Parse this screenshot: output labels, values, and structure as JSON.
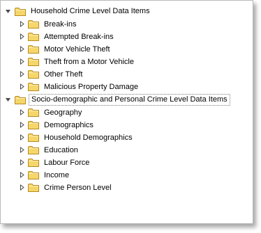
{
  "tree": {
    "groups": [
      {
        "label": "Household Crime Level Data Items",
        "expanded": true,
        "selected": false,
        "children": [
          {
            "label": "Break-ins"
          },
          {
            "label": "Attempted Break-ins"
          },
          {
            "label": "Motor Vehicle Theft"
          },
          {
            "label": "Theft from a Motor Vehicle"
          },
          {
            "label": "Other Theft"
          },
          {
            "label": "Malicious Property Damage"
          }
        ]
      },
      {
        "label": "Socio-demographic and Personal Crime Level Data Items",
        "expanded": true,
        "selected": true,
        "children": [
          {
            "label": "Geography"
          },
          {
            "label": "Demographics"
          },
          {
            "label": "Household Demographics"
          },
          {
            "label": "Education"
          },
          {
            "label": "Labour Force"
          },
          {
            "label": "Income"
          },
          {
            "label": "Crime Person Level"
          }
        ]
      }
    ]
  },
  "icons": {
    "expanded": "triangle-down-icon",
    "collapsed": "triangle-right-icon",
    "folder": "folder-icon"
  },
  "colors": {
    "folder_fill": "#f5d66a",
    "folder_stroke": "#b88a1e",
    "expander": "#4a4a4a",
    "selection_border": "#7a7a7a"
  }
}
